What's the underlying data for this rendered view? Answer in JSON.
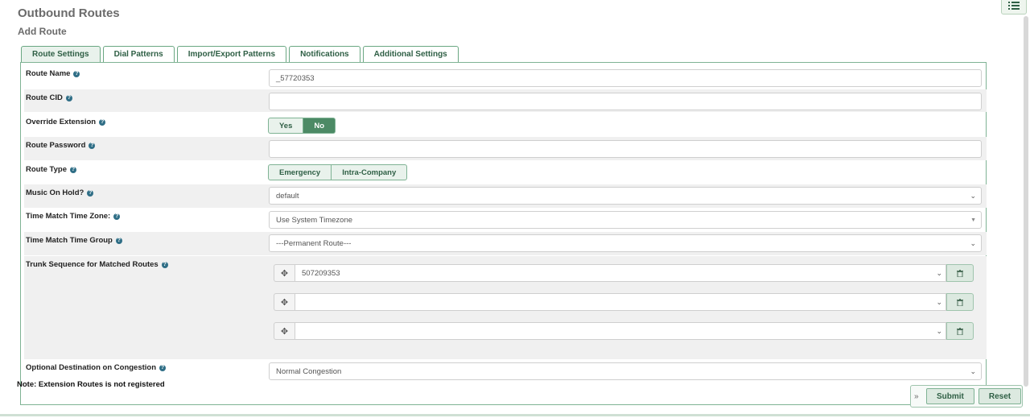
{
  "header": {
    "title": "Outbound Routes",
    "subtitle": "Add Route"
  },
  "tabs": [
    {
      "label": "Route Settings",
      "active": true
    },
    {
      "label": "Dial Patterns"
    },
    {
      "label": "Import/Export Patterns"
    },
    {
      "label": "Notifications"
    },
    {
      "label": "Additional Settings"
    }
  ],
  "form": {
    "route_name": {
      "label": "Route Name",
      "value": "_57720353"
    },
    "route_cid": {
      "label": "Route CID",
      "value": ""
    },
    "override_extension": {
      "label": "Override Extension",
      "options": [
        "Yes",
        "No"
      ],
      "selected": "No"
    },
    "route_password": {
      "label": "Route Password",
      "value": ""
    },
    "route_type": {
      "label": "Route Type",
      "options": [
        "Emergency",
        "Intra-Company"
      ]
    },
    "music_on_hold": {
      "label": "Music On Hold?",
      "value": "default"
    },
    "time_zone": {
      "label": "Time Match Time Zone:",
      "value": "Use System Timezone"
    },
    "time_group": {
      "label": "Time Match Time Group",
      "value": "---Permanent Route---"
    },
    "trunk_sequence": {
      "label": "Trunk Sequence for Matched Routes",
      "trunks": [
        "507209353",
        "",
        ""
      ]
    },
    "congestion": {
      "label": "Optional Destination on Congestion",
      "value": "Normal Congestion"
    }
  },
  "note": "Note: Extension Routes is not registered",
  "footer": {
    "arrow": "»",
    "submit": "Submit",
    "reset": "Reset"
  },
  "colors": {
    "accent": "#4c8a65",
    "border": "#7fb394",
    "help": "#2f6e86"
  },
  "icons": [
    "list-icon",
    "help-icon",
    "move-icon",
    "trash-icon",
    "chevron-down-icon"
  ]
}
